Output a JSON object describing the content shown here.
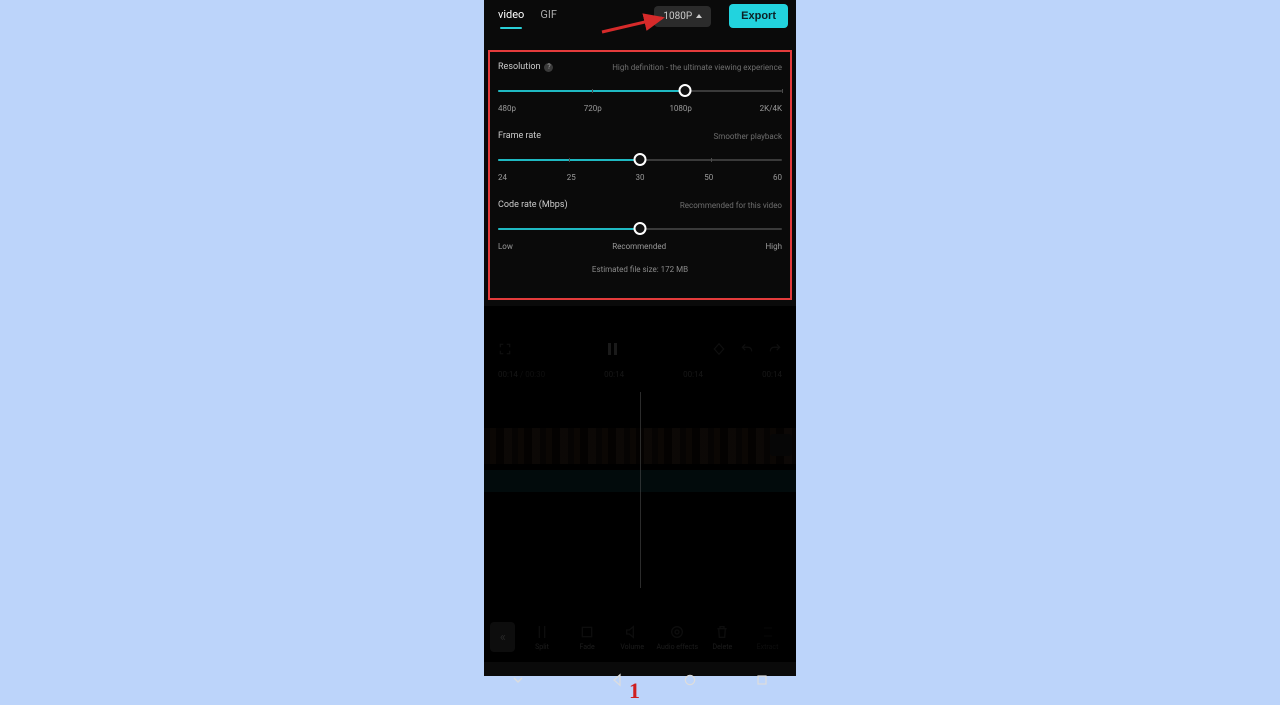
{
  "tabs": {
    "video": "video",
    "gif": "GIF"
  },
  "resolutionPill": "1080P",
  "exportLabel": "Export",
  "settings": {
    "resolution": {
      "label": "Resolution",
      "hint": "High definition - the ultimate viewing experience",
      "ticks": [
        "480p",
        "720p",
        "1080p",
        "2K/4K"
      ],
      "fillPct": 66,
      "thumbPct": 66
    },
    "framerate": {
      "label": "Frame rate",
      "hint": "Smoother playback",
      "ticks": [
        "24",
        "25",
        "30",
        "50",
        "60"
      ],
      "fillPct": 50,
      "thumbPct": 50
    },
    "coderate": {
      "label": "Code rate (Mbps)",
      "hint": "Recommended for this video",
      "ticks": [
        "Low",
        "Recommended",
        "High"
      ],
      "fillPct": 50,
      "thumbPct": 50
    },
    "estimate": "Estimated file size: 172 MB"
  },
  "timebar": {
    "t1": "00:14",
    "t1b": "/ 00:30",
    "t2": "00:14",
    "t3": "00:14",
    "t4": "00:14"
  },
  "tools": {
    "split": "Split",
    "fade": "Fade",
    "volume": "Volume",
    "audioEffects": "Audio effects",
    "delete": "Delete",
    "extract": "Extract"
  },
  "stepNumber": "1"
}
